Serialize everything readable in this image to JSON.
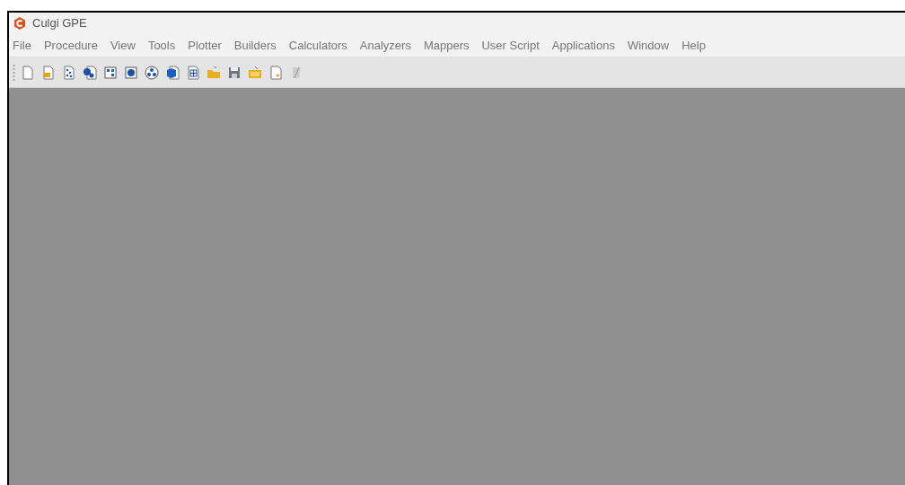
{
  "window": {
    "title": "Culgi GPE"
  },
  "menu": [
    "File",
    "Procedure",
    "View",
    "Tools",
    "Plotter",
    "Builders",
    "Calculators",
    "Analyzers",
    "Mappers",
    "User Script",
    "Applications",
    "Window",
    "Help"
  ]
}
